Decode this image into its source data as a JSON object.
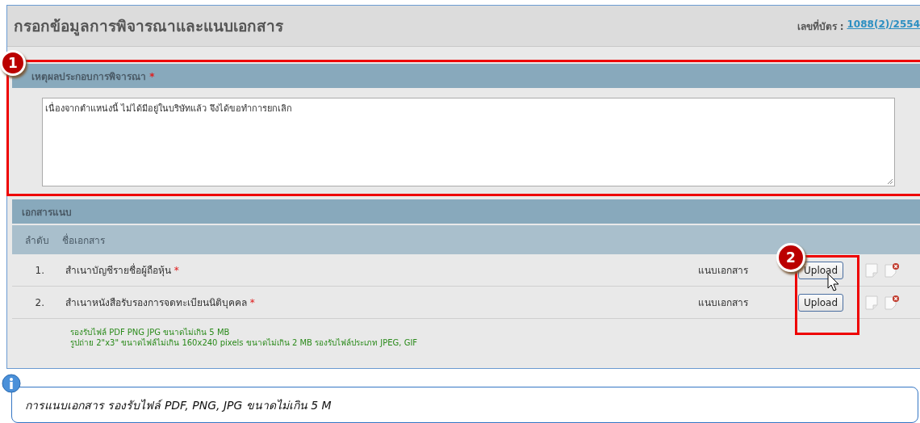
{
  "page": {
    "title": "กรอกข้อมูลการพิจารณาและแนบเอกสาร",
    "card_label": "เลขที่บัตร :",
    "card_number": "1088(2)/2554"
  },
  "reason": {
    "label": "เหตุผลประกอบการพิจารณา",
    "required_mark": "*",
    "value": "เนื่องจากตำแหน่งนี้ ไม่ได้มีอยู่ในบริษัทแล้ว จึงได้ขอทำการยกเลิก",
    "callout": "1"
  },
  "attachments": {
    "title": "เอกสารแนบ",
    "columns": [
      "ลำดับ",
      "ชื่อเอกสาร"
    ],
    "callout": "2",
    "rows": [
      {
        "index": "1.",
        "name": "สำเนาบัญชีรายชื่อผู้ถือหุ้น",
        "required_mark": "*",
        "status": "แนบเอกสาร",
        "button": "Upload",
        "hovered": true
      },
      {
        "index": "2.",
        "name": "สำเนาหนังสือรับรองการจดทะเบียนนิติบุคคล",
        "required_mark": "*",
        "status": "แนบเอกสาร",
        "button": "Upload",
        "hovered": false
      }
    ],
    "notes": [
      "รองรับไฟล์ PDF PNG JPG ขนาดไม่เกิน 5 MB",
      "รูปถ่าย 2\"x3\" ขนาดไฟล์ไม่เกิน 160x240 pixels ขนาดไม่เกิน 2 MB รองรับไฟล์ประเภท JPEG, GIF"
    ]
  },
  "info": {
    "text": "การแนบเอกสาร รองรับไฟล์ PDF, PNG, JPG ขนาดไม่เกิน 5 M"
  }
}
